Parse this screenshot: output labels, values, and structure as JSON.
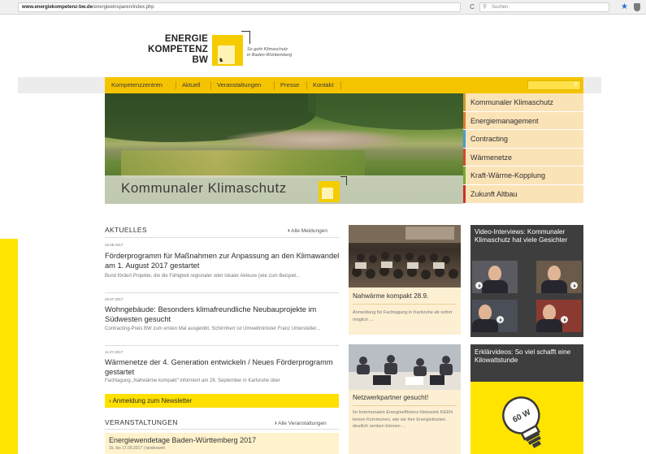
{
  "browser": {
    "url_domain": "www.energiekompetenz-bw.de",
    "url_path": "/energieeinsparen/index.php",
    "reload_icon": "C",
    "search_placeholder": "Suchen"
  },
  "header": {
    "logo_line1": "ENERGIE",
    "logo_line2": "KOMPETENZ",
    "logo_line3": "BW",
    "tagline_line1": "So geht Klimaschutz",
    "tagline_line2": "in Baden-Württemberg"
  },
  "nav": {
    "items": [
      "Kompetenzzentren",
      "Aktuell",
      "Veranstaltungen",
      "Presse",
      "Kontakt"
    ]
  },
  "hero": {
    "title": "Kommunaler Klimaschutz"
  },
  "right_menu": {
    "items": [
      {
        "label": "Kommunaler Klimaschutz",
        "color": "#c89a2a"
      },
      {
        "label": "Energiemanagement",
        "color": "#e07a2a"
      },
      {
        "label": "Contracting",
        "color": "#4a9ad4"
      },
      {
        "label": "Wärmenetze",
        "color": "#d24a2a"
      },
      {
        "label": "Kraft-Wärme-Kopplung",
        "color": "#7aaa3a"
      },
      {
        "label": "Zukunft Altbau",
        "color": "#c8322a"
      }
    ]
  },
  "aktuelles": {
    "heading": "AKTUELLES",
    "all_link": "Alle Meldungen",
    "news": [
      {
        "date": "22.08.2017",
        "title": "Förderprogramm für Maßnahmen zur Anpassung an den Klimawandel am 1. August 2017 gestartet",
        "desc": "Bund fördert Projekte, die die Fähigkeit regionaler oder lokaler Akteure (wie zum Beispiel..."
      },
      {
        "date": "20.07.2017",
        "title": "Wohngebäude: Besonders klimafreundliche Neubauprojekte im Südwesten gesucht",
        "desc": "Contracting-Preis BW zum ersten Mal ausgelobt. Schirmherr ist Umweltminister Franz Untersteller..."
      },
      {
        "date": "11.07.2017",
        "title": "Wärmenetze der 4. Generation entwickeln / Neues Förderprogramm gestartet",
        "desc": "Fachtagung „Nahwärme kompakt“ informiert am 28. September in Karlsruhe über"
      }
    ],
    "newsletter_label": "› Anmeldung zum Newsletter"
  },
  "veranstaltungen": {
    "heading": "VERANSTALTUNGEN",
    "all_link": "Alle Veranstaltungen",
    "event_title": "Energiewendetage Baden-Württemberg 2017",
    "event_date": "15. bis 17.09.2017 | landesweit"
  },
  "cards": [
    {
      "title": "Nahwärme kompakt 28.9.",
      "desc": "Anmeldung für Fachtagung in Karlsruhe ab sofort möglich ..."
    },
    {
      "title": "Netzwerkpartner gesucht!",
      "desc": "Im kommunalen Energieeffizienz-Netzwerk KEEN lernen Kommunen, wie sie ihre Energiekosten deutlich senken können ..."
    }
  ],
  "video_panel": {
    "title": "Video-Interviews: Kommunaler Klimaschutz hat viele Gesichter"
  },
  "explain_panel": {
    "title": "Erklärvideos: So viel schafft eine Kilowattstunde",
    "bulb_label": "60 W"
  }
}
